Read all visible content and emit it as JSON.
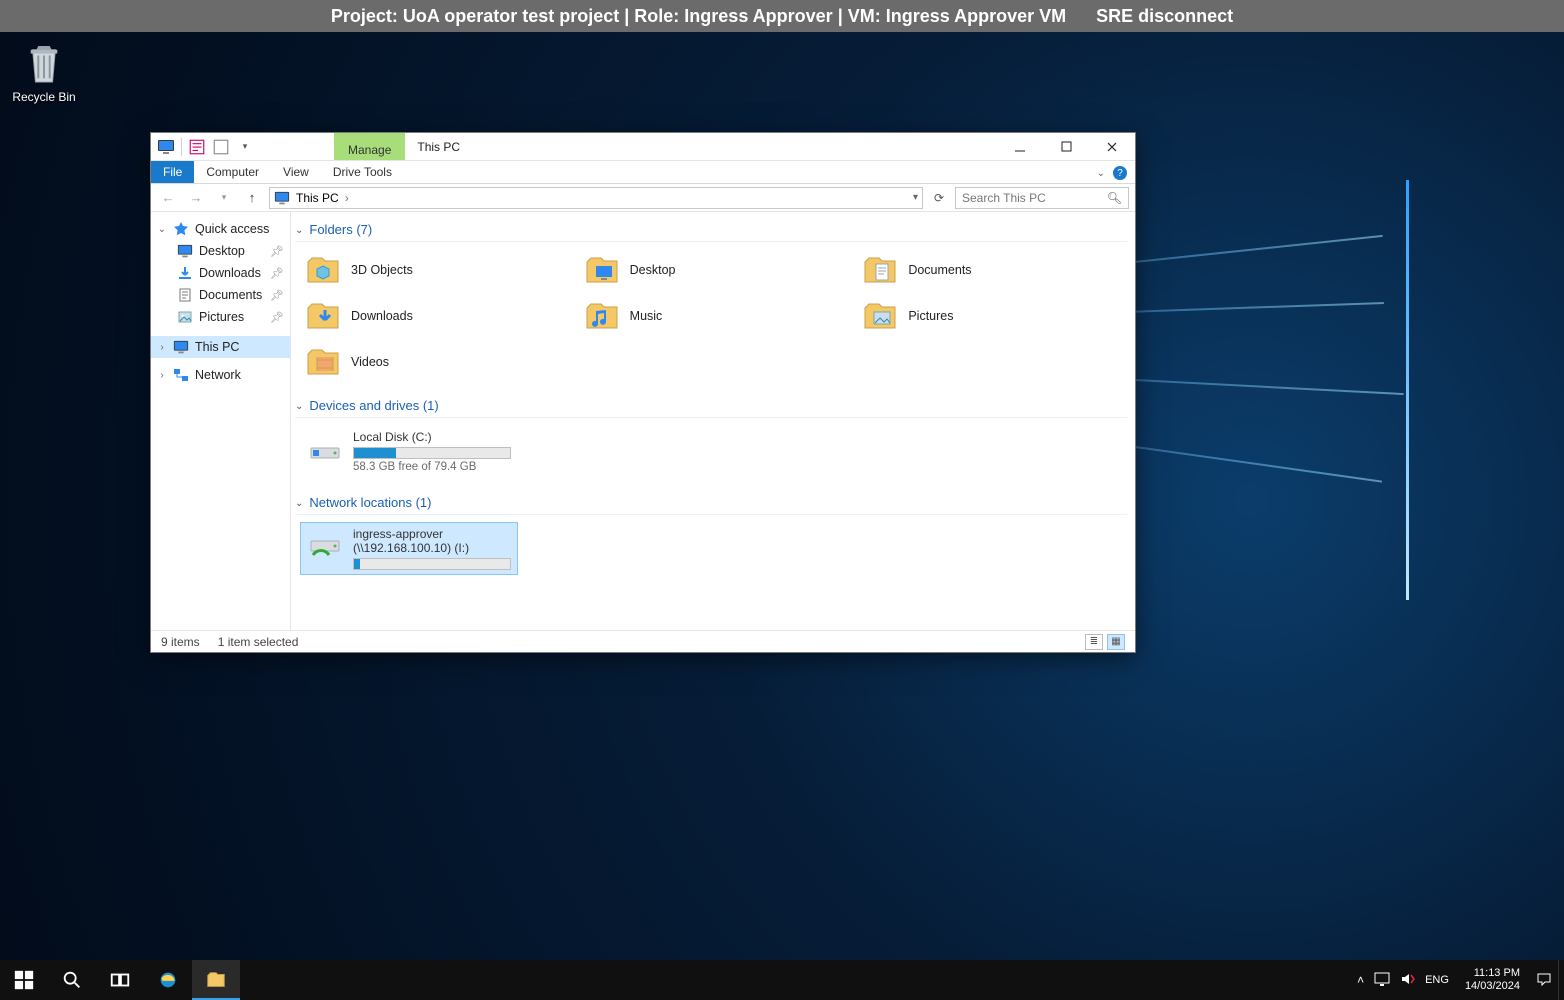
{
  "infobar": {
    "project": "Project: UoA operator test project",
    "role": "Role: Ingress Approver",
    "vm": "VM: Ingress Approver VM",
    "disconnect": "SRE disconnect"
  },
  "desktop": {
    "recycle_bin": "Recycle Bin"
  },
  "window": {
    "context_tab": "Manage",
    "title": "This PC",
    "ribbon": {
      "file": "File",
      "computer": "Computer",
      "view": "View",
      "drive_tools": "Drive Tools"
    },
    "breadcrumb": {
      "root": "This PC"
    },
    "search_placeholder": "Search This PC",
    "sidebar": {
      "quick_access": "Quick access",
      "items": [
        {
          "label": "Desktop"
        },
        {
          "label": "Downloads"
        },
        {
          "label": "Documents"
        },
        {
          "label": "Pictures"
        }
      ],
      "this_pc": "This PC",
      "network": "Network"
    },
    "groups": {
      "folders_hdr": "Folders (7)",
      "folders": [
        "3D Objects",
        "Desktop",
        "Documents",
        "Downloads",
        "Music",
        "Pictures",
        "Videos"
      ],
      "drives_hdr": "Devices and drives (1)",
      "local_disk": {
        "name": "Local Disk (C:)",
        "detail": "58.3 GB free of 79.4 GB",
        "fill_pct": 27
      },
      "netloc_hdr": "Network locations (1)",
      "net_drive": {
        "name": "ingress-approver (\\\\192.168.100.10) (I:)",
        "fill_pct": 4
      }
    },
    "status": {
      "count": "9 items",
      "selected": "1 item selected"
    }
  },
  "taskbar": {
    "lang": "ENG",
    "time": "11:13 PM",
    "date": "14/03/2024"
  }
}
